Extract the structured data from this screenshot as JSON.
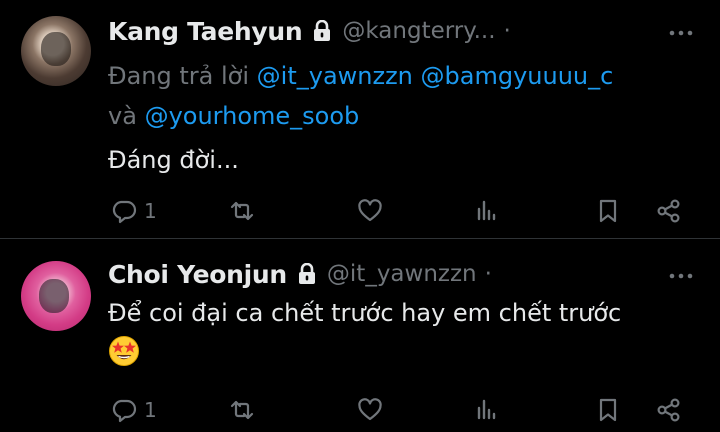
{
  "tweets": [
    {
      "name": "Kang Taehyun",
      "handle": "@kangterry...",
      "separator": "·",
      "replying_prefix": "Đang trả lời",
      "replying_mentions": [
        "@it_yawnzzn",
        "@bamgyuuuu_c"
      ],
      "replying_joiner": "và",
      "replying_last": "@yourhome_soob",
      "text": "Đáng đời...",
      "reply_count": "1"
    },
    {
      "name": "Choi Yeonjun",
      "handle": "@it_yawnzzn",
      "separator": "·",
      "text": "Để coi đại ca chết trước hay em chết trước",
      "emoji": "star-struck-emoji",
      "reply_count": "1"
    }
  ],
  "colors": {
    "background": "#000000",
    "text": "#e7e9ea",
    "muted": "#71767b",
    "mention": "#1d9bf0"
  },
  "icons": [
    "lock-icon",
    "more-icon",
    "reply-icon",
    "retweet-icon",
    "like-icon",
    "views-icon",
    "bookmark-icon",
    "share-icon"
  ]
}
